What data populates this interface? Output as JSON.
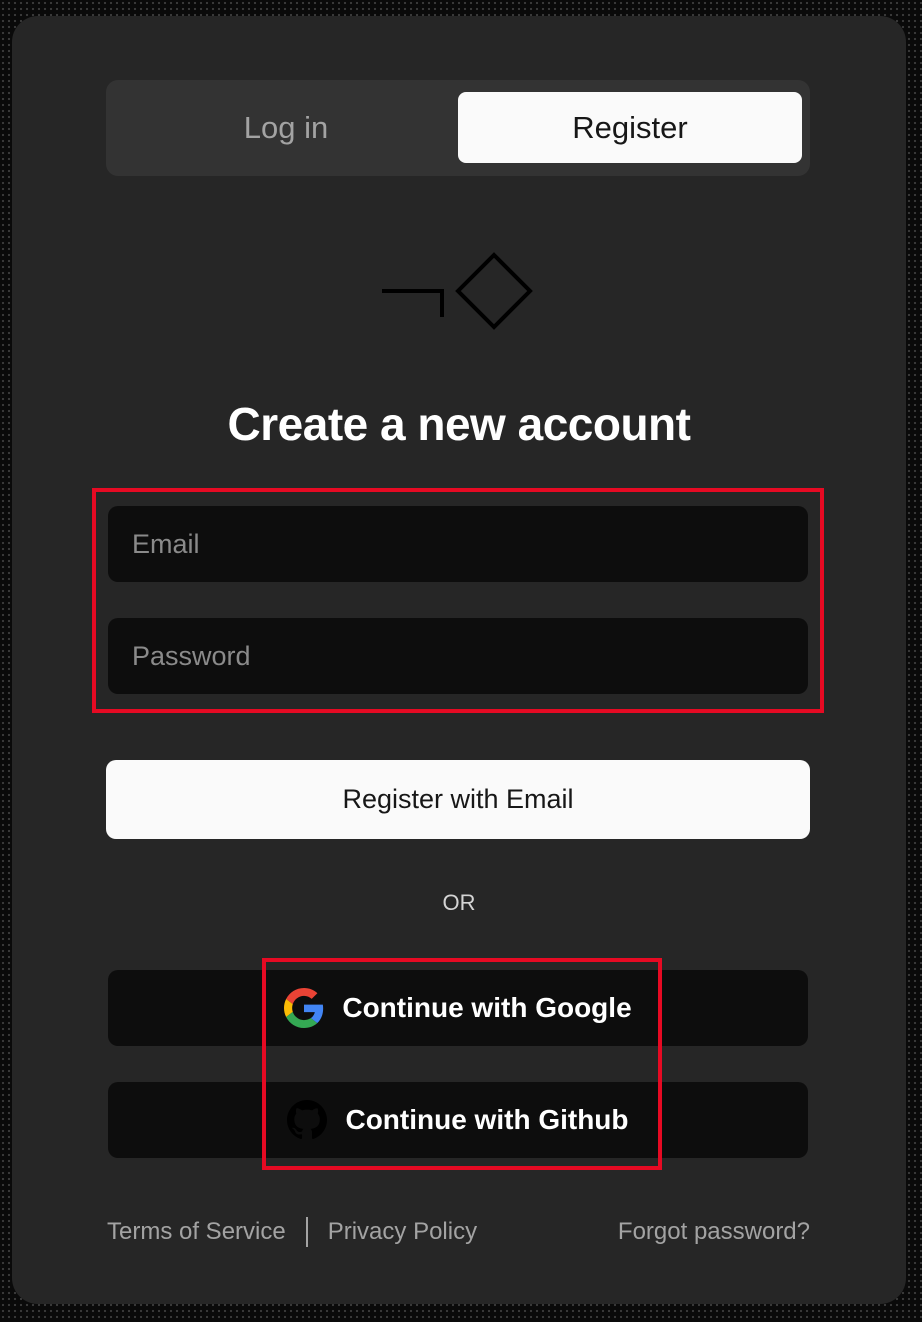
{
  "tabs": {
    "login_label": "Log in",
    "register_label": "Register",
    "active": "register"
  },
  "logo": {
    "icon": "logo-mark-icon"
  },
  "heading": "Create a new account",
  "form": {
    "email_placeholder": "Email",
    "password_placeholder": "Password",
    "email_value": "",
    "password_value": "",
    "submit_label": "Register with Email"
  },
  "divider_label": "OR",
  "social": {
    "google_label": "Continue with Google",
    "google_icon": "google-icon",
    "github_label": "Continue with Github",
    "github_icon": "github-icon"
  },
  "footer": {
    "terms_label": "Terms of Service",
    "privacy_label": "Privacy Policy",
    "forgot_label": "Forgot password?"
  },
  "colors": {
    "page_bg": "#0a0a0a",
    "card_bg": "#262626",
    "field_bg": "#0d0d0d",
    "primary_button_bg": "#fafafa",
    "highlight": "#e60a23"
  }
}
